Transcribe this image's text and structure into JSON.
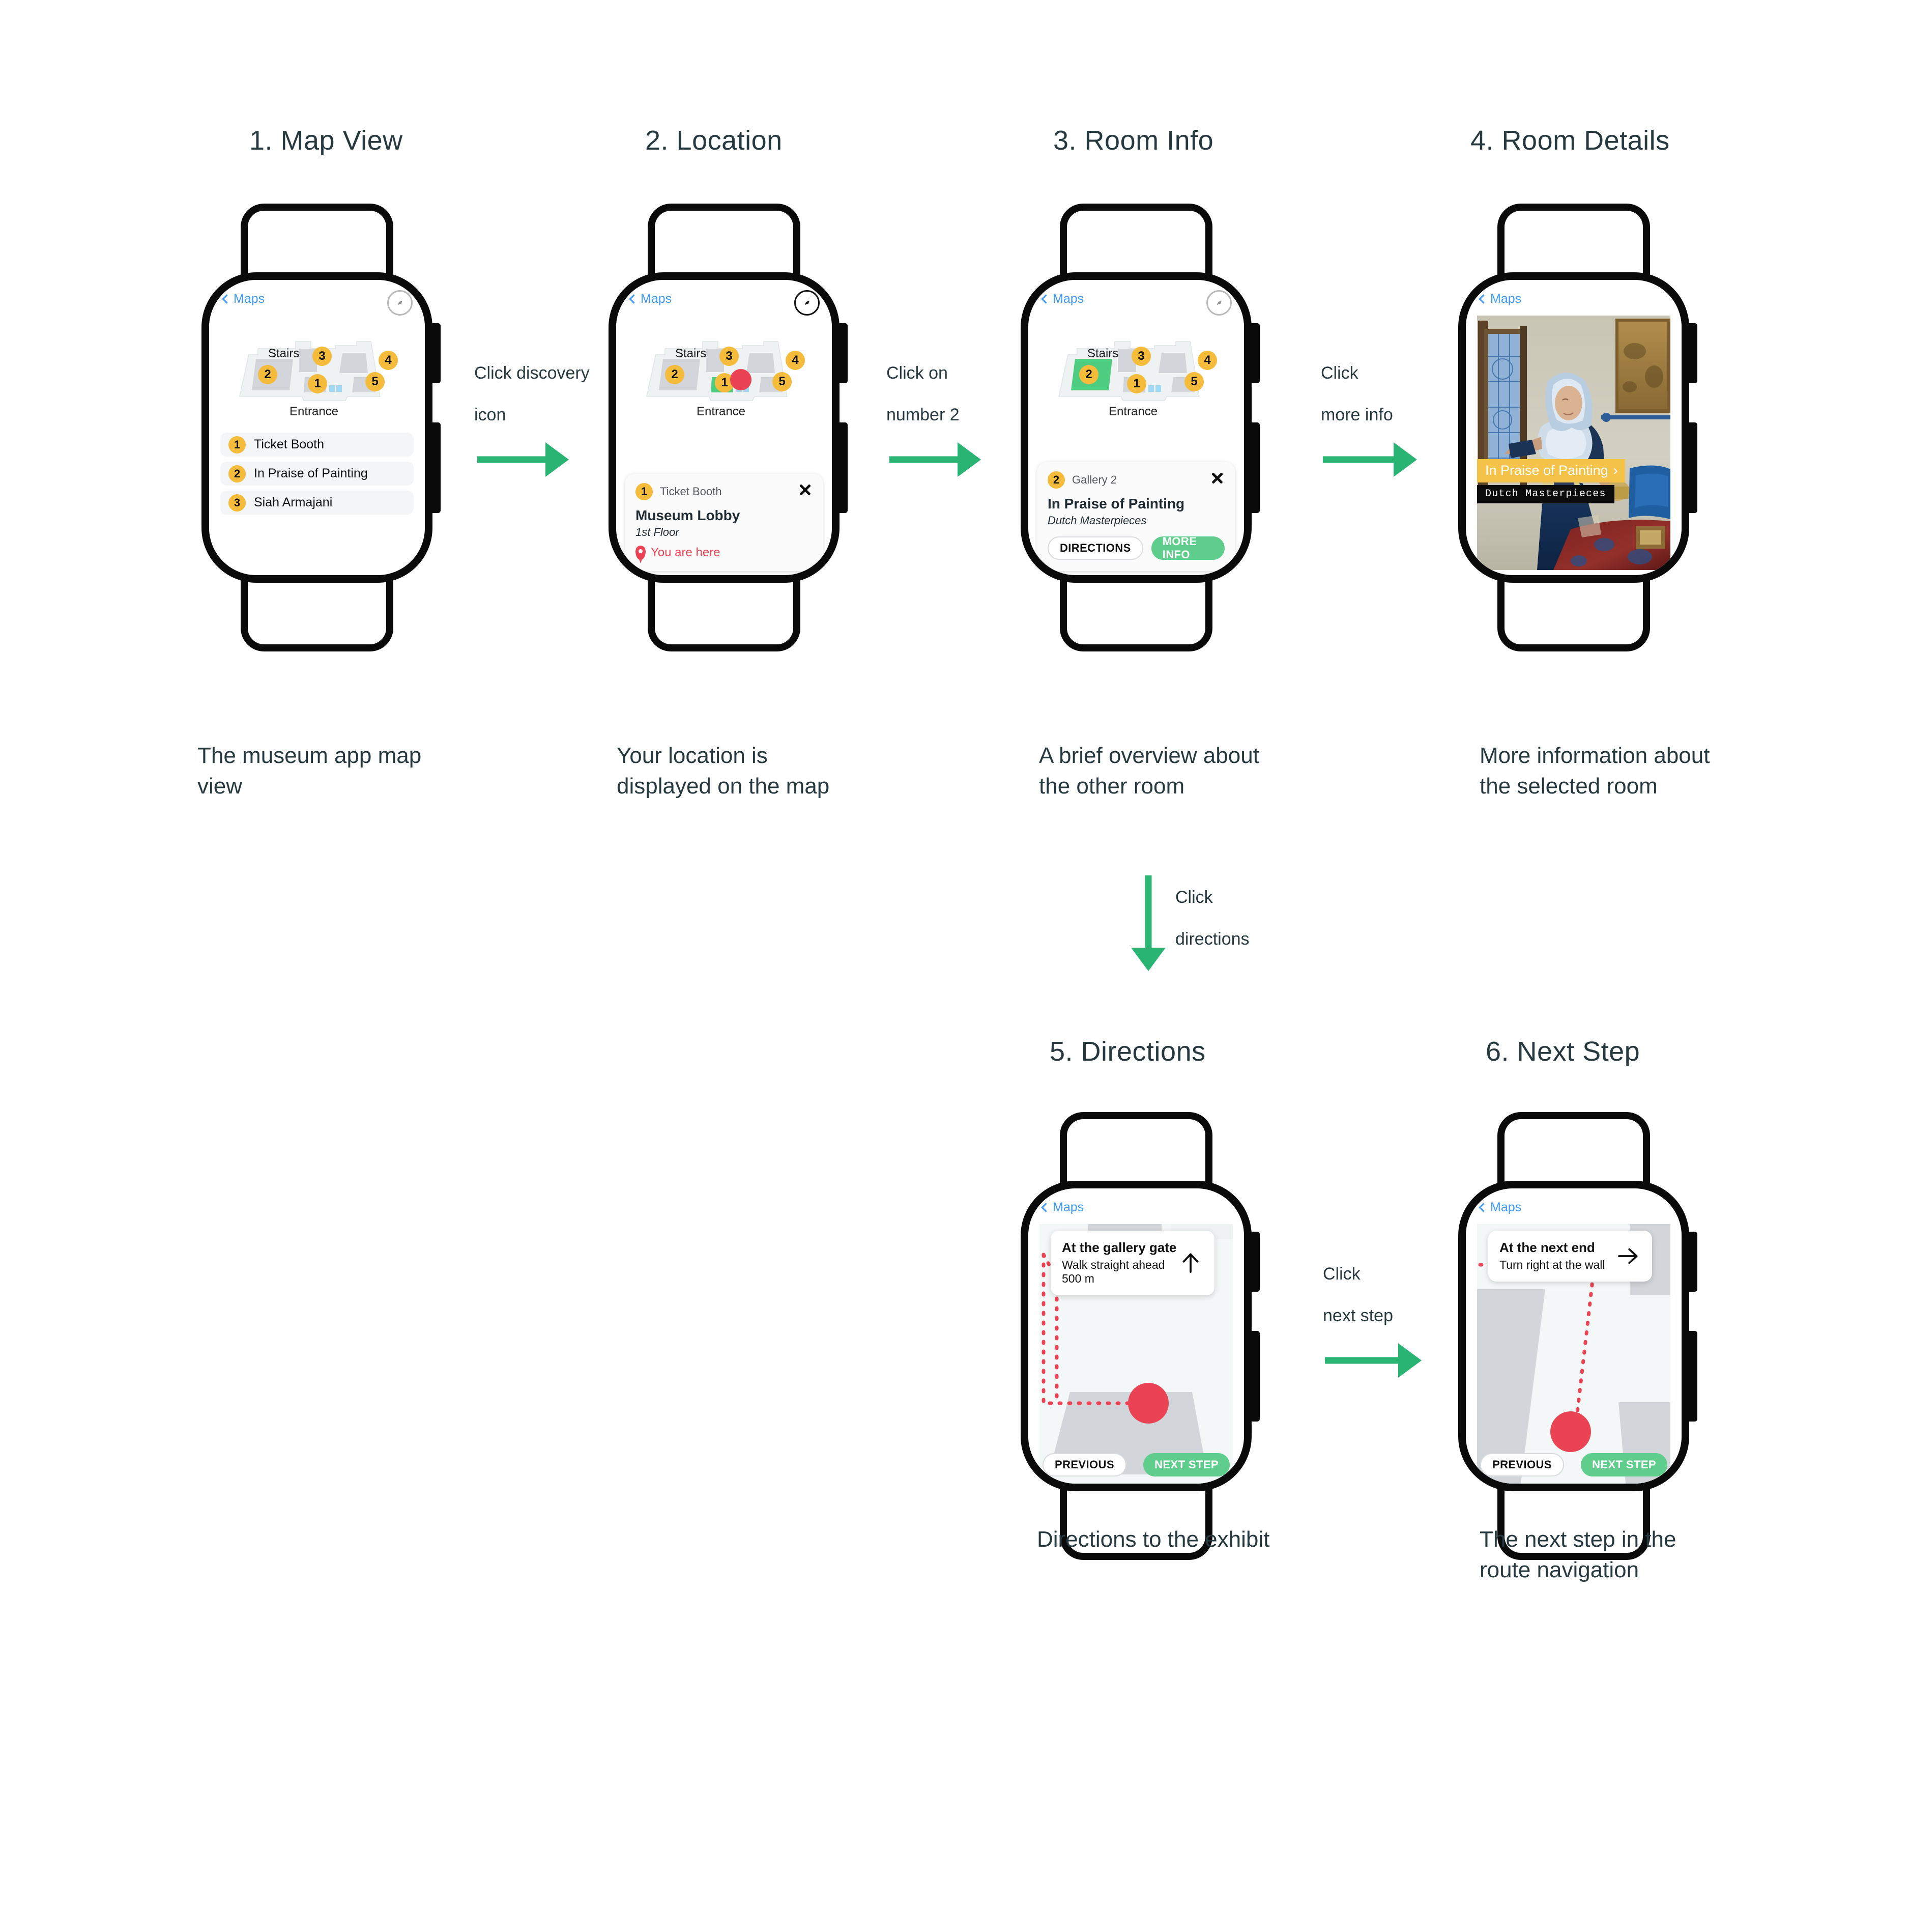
{
  "flow": {
    "steps": [
      {
        "id": "map-view",
        "title": "1. Map View",
        "caption": "The museum app map view"
      },
      {
        "id": "location",
        "title": "2. Location",
        "caption": "Your location is displayed on the map"
      },
      {
        "id": "room-info",
        "title": "3. Room Info",
        "caption": "A brief overview about the other room"
      },
      {
        "id": "room-details",
        "title": "4. Room Details",
        "caption": "More information about the selected room"
      },
      {
        "id": "directions",
        "title": "5. Directions",
        "caption": "Directions to the exhibit"
      },
      {
        "id": "next-step",
        "title": "6. Next Step",
        "caption": "The next step in the route navigation"
      }
    ],
    "transitions": [
      {
        "id": "t1",
        "line1": "Click discovery",
        "line2": "icon",
        "direction": "right"
      },
      {
        "id": "t2",
        "line1": "Click on",
        "line2": "number 2",
        "direction": "right"
      },
      {
        "id": "t3",
        "line1": "Click",
        "line2": "more info",
        "direction": "right"
      },
      {
        "id": "t4",
        "line1": "Click",
        "line2": "directions",
        "direction": "down"
      },
      {
        "id": "t5",
        "line1": "Click",
        "line2": "next step",
        "direction": "right"
      }
    ]
  },
  "screens": {
    "map_view": {
      "nav": {
        "back_label": "Maps",
        "compass_icon": "compass-icon"
      },
      "map": {
        "stairs_label": "Stairs",
        "entrance_label": "Entrance",
        "markers": [
          "1",
          "2",
          "3",
          "4",
          "5"
        ],
        "restroom_icon": "restroom-icon"
      },
      "poi_list": [
        {
          "number": "1",
          "name": "Ticket Booth"
        },
        {
          "number": "2",
          "name": "In Praise of Painting"
        },
        {
          "number": "3",
          "name": "Siah Armajani"
        }
      ]
    },
    "location": {
      "nav": {
        "back_label": "Maps",
        "compass_icon": "compass-icon"
      },
      "map": {
        "stairs_label": "Stairs",
        "entrance_label": "Entrance",
        "markers": [
          "1",
          "2",
          "3",
          "4",
          "5"
        ],
        "highlighted_room": "1",
        "user_position_icon": "user-location-dot"
      },
      "card": {
        "badge": "1",
        "badge_label": "Ticket Booth",
        "title": "Museum Lobby",
        "subtitle": "1st Floor",
        "status": "You are here",
        "status_icon": "map-pin-icon",
        "close_icon": "close-icon"
      }
    },
    "room_info": {
      "nav": {
        "back_label": "Maps",
        "compass_icon": "compass-icon"
      },
      "map": {
        "stairs_label": "Stairs",
        "entrance_label": "Entrance",
        "markers": [
          "1",
          "2",
          "3",
          "4",
          "5"
        ],
        "highlighted_room": "2"
      },
      "card": {
        "badge": "2",
        "badge_label": "Gallery 2",
        "title": "In Praise of Painting",
        "subtitle": "Dutch Masterpieces",
        "close_icon": "close-icon",
        "directions_button": "DIRECTIONS",
        "more_info_button": "MORE INFO"
      }
    },
    "room_details": {
      "nav": {
        "back_label": "Maps"
      },
      "artwork": {
        "banner_title": "In Praise of Painting",
        "banner_chevron_icon": "chevron-right-icon",
        "subtitle": "Dutch Masterpieces"
      }
    },
    "directions": {
      "nav": {
        "back_label": "Maps"
      },
      "instruction": {
        "title": "At the gallery gate",
        "detail": "Walk straight ahead 500 m",
        "arrow_icon": "arrow-up-icon"
      },
      "buttons": {
        "previous": "PREVIOUS",
        "next": "NEXT STEP"
      }
    },
    "next_step": {
      "nav": {
        "back_label": "Maps"
      },
      "instruction": {
        "title": "At the next end",
        "detail": "Turn right at the wall",
        "arrow_icon": "arrow-right-icon"
      },
      "buttons": {
        "previous": "PREVIOUS",
        "next": "NEXT STEP"
      }
    }
  },
  "colors": {
    "accent_green": "#2ab473",
    "button_green": "#5fcd8c",
    "marker_yellow": "#f5bc3c",
    "banner_yellow": "#f5c24a",
    "user_red": "#ea4354",
    "link_blue": "#3d9bf5",
    "text_dark": "#26393f",
    "room_fill": "#d2d5d9",
    "floor_fill": "#eef2f3",
    "highlight_green": "#4ecd80"
  }
}
